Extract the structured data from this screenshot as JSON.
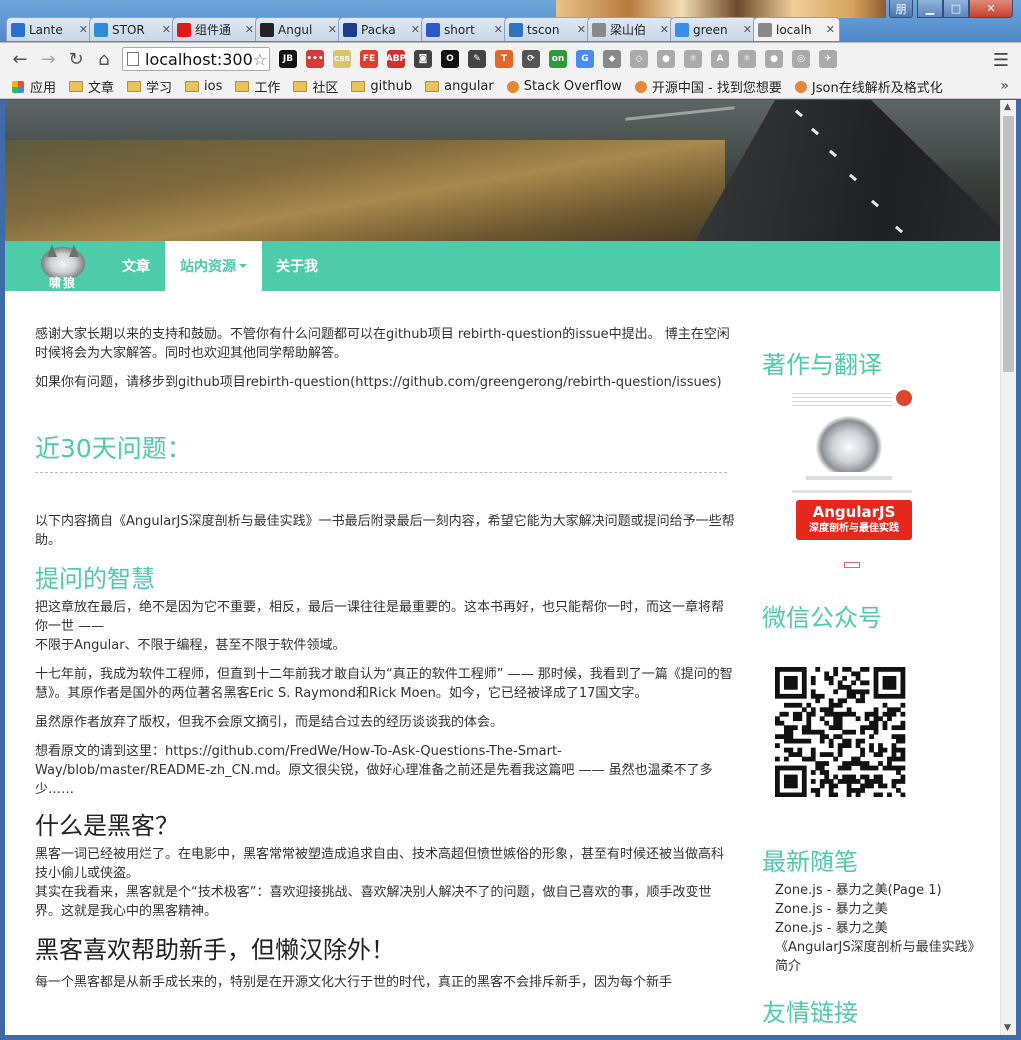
{
  "browser": {
    "tabs": [
      {
        "label": "Lante",
        "icon": "upload-arrow-icon",
        "color": "#2a6fcf"
      },
      {
        "label": "STOR",
        "icon": "globe-icon",
        "color": "#2e8bd6"
      },
      {
        "label": "组件通",
        "icon": "angular-icon",
        "color": "#dd1b16"
      },
      {
        "label": "Angul",
        "icon": "github-icon",
        "color": "#222222"
      },
      {
        "label": "Packa",
        "icon": "n-icon",
        "color": "#1a3d8c"
      },
      {
        "label": "short",
        "icon": "paw-icon",
        "color": "#2a59c8"
      },
      {
        "label": "tscon",
        "icon": "ts-icon",
        "color": "#2f74c0"
      },
      {
        "label": "梁山伯",
        "icon": "page-icon",
        "color": "#888888"
      },
      {
        "label": "green",
        "icon": "loading-icon",
        "color": "#3a8ee6"
      },
      {
        "label": "localh",
        "icon": "page-icon",
        "color": "#888888",
        "active": true
      }
    ],
    "window_user": "朋",
    "address": "localhost:300",
    "bookmarks": [
      {
        "label": "应用",
        "type": "apps"
      },
      {
        "label": "文章",
        "type": "folder"
      },
      {
        "label": "学习",
        "type": "folder"
      },
      {
        "label": "ios",
        "type": "folder"
      },
      {
        "label": "工作",
        "type": "folder"
      },
      {
        "label": "社区",
        "type": "folder"
      },
      {
        "label": "github",
        "type": "folder"
      },
      {
        "label": "angular",
        "type": "folder"
      },
      {
        "label": "Stack Overflow",
        "type": "link"
      },
      {
        "label": "开源中国 - 找到您想要",
        "type": "link"
      },
      {
        "label": "Json在线解析及格式化",
        "type": "link"
      }
    ],
    "extensions": [
      {
        "label": "JB",
        "color": "#111111"
      },
      {
        "label": "•••",
        "color": "#d43a3a"
      },
      {
        "label": "css",
        "color": "#d8c46a"
      },
      {
        "label": "FE",
        "color": "#e23c2e"
      },
      {
        "label": "ABP",
        "color": "#d32f2f"
      },
      {
        "label": "◙",
        "color": "#444444"
      },
      {
        "label": "O",
        "color": "#111111"
      },
      {
        "label": "✎",
        "color": "#444444"
      },
      {
        "label": "T",
        "color": "#e0662a"
      },
      {
        "label": "⟳",
        "color": "#555555"
      },
      {
        "label": "on",
        "color": "#2e9b3a"
      },
      {
        "label": "G",
        "color": "#4a8af4"
      },
      {
        "label": "◆",
        "color": "#888888"
      },
      {
        "label": "◇",
        "color": "#aaaaaa"
      },
      {
        "label": "●",
        "color": "#aaaaaa"
      },
      {
        "label": "⚛",
        "color": "#aaaaaa"
      },
      {
        "label": "A",
        "color": "#aaaaaa"
      },
      {
        "label": "⚛",
        "color": "#aaaaaa"
      },
      {
        "label": "●",
        "color": "#aaaaaa"
      },
      {
        "label": "◎",
        "color": "#aaaaaa"
      },
      {
        "label": "✈",
        "color": "#aaaaaa"
      }
    ]
  },
  "site": {
    "brand": "啸狼",
    "nav": [
      {
        "label": "文章"
      },
      {
        "label": "站内资源",
        "active": true
      },
      {
        "label": "关于我"
      }
    ],
    "accent": "#4ecba8"
  },
  "content": {
    "intro1": "感谢大家长期以来的支持和鼓励。不管你有什么问题都可以在github项目 rebirth-question的issue中提出。 博主在空闲时候将会为大家解答。同时也欢迎其他同学帮助解答。",
    "intro2": "如果你有问题，请移步到github项目rebirth-question(https://github.com/greengerong/rebirth-question/issues)",
    "recent_title": "近30天问题：",
    "source_note": "以下内容摘自《AngularJS深度剖析与最佳实践》一书最后附录最后一刻内容，希望它能为大家解决问题或提问给予一些帮助。",
    "wisdom_title": "提问的智慧",
    "wisdom_p1_a": "把这章放在最后，绝不是因为它不重要，相反，最后一课往往是最重要的。这本书再好，也只能帮你一时，而这一章将帮你一世 ——",
    "wisdom_p1_b": "不限于Angular、不限于编程，甚至不限于软件领域。",
    "wisdom_p2": "十七年前，我成为软件工程师，但直到十二年前我才敢自认为“真正的软件工程师” —— 那时候，我看到了一篇《提问的智慧》。其原作者是国外的两位著名黑客Eric S. Raymond和Rick Moen。如今，它已经被译成了17国文字。",
    "wisdom_p3": "虽然原作者放弃了版权，但我不会原文摘引，而是结合过去的经历谈谈我的体会。",
    "wisdom_p4": "想看原文的请到这里：https://github.com/FredWe/How-To-Ask-Questions-The-Smart-Way/blob/master/README-zh_CN.md。原文很尖锐，做好心理准备之前还是先看我这篇吧 —— 虽然也温柔不了多少……",
    "hacker_title": "什么是黑客？",
    "hacker_p1": "黑客一词已经被用烂了。在电影中，黑客常常被塑造成追求自由、技术高超但愤世嫉俗的形象，甚至有时候还被当做高科技小偷儿或侠盗。",
    "hacker_p2": "其实在我看来，黑客就是个“技术极客”：喜欢迎接挑战、喜欢解决别人解决不了的问题，做自己喜欢的事，顺手改变世界。这就是我心中的黑客精神。",
    "help_title": "黑客喜欢帮助新手，但懒汉除外！",
    "help_p1": "每一个黑客都是从新手成长来的，特别是在开源文化大行于世的时代，真正的黑客不会排斥新手，因为每个新手"
  },
  "sidebar": {
    "books_title": "著作与翻译",
    "book": {
      "cover_title": "AngularJS",
      "cover_subtitle": "深度剖析与最佳实践"
    },
    "wechat_title": "微信公众号",
    "recent_title": "最新随笔",
    "recent_posts": [
      "Zone.js - 暴力之美(Page 1)",
      "Zone.js - 暴力之美",
      "Zone.js - 暴力之美",
      "《AngularJS深度剖析与最佳实践》简介"
    ],
    "links_title": "友情链接"
  }
}
